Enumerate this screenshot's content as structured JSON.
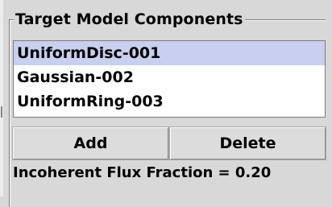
{
  "panel": {
    "title": "Target Model Components"
  },
  "components": [
    {
      "label": "UniformDisc-001",
      "selected": true
    },
    {
      "label": "Gaussian-002",
      "selected": false
    },
    {
      "label": "UniformRing-003",
      "selected": false
    }
  ],
  "buttons": {
    "add_label": "Add",
    "delete_label": "Delete"
  },
  "status": {
    "flux_text": "Incoherent Flux Fraction = 0.20"
  },
  "colors": {
    "background": "#d8d8d8",
    "selection": "#c8cfef"
  }
}
